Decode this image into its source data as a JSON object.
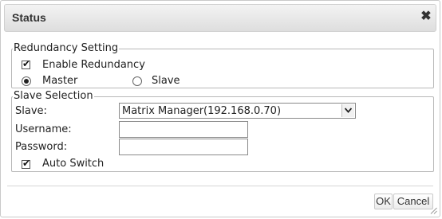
{
  "dialog": {
    "title": "Status",
    "close_glyph": "✖",
    "close_icon": "close-icon"
  },
  "redundancy": {
    "legend": "Redundancy Setting",
    "enable_label": "Enable Redundancy",
    "enable_checked": true,
    "role_options": [
      "Master",
      "Slave"
    ],
    "role_selected": "Master"
  },
  "slave_selection": {
    "legend": "Slave Selection",
    "slave_label": "Slave:",
    "slave_value": "Matrix Manager(192.168.0.70)",
    "username_label": "Username:",
    "username_value": "",
    "password_label": "Password:",
    "password_value": "",
    "auto_switch_label": "Auto Switch",
    "auto_switch_checked": true
  },
  "footer": {
    "ok_label": "OK",
    "cancel_label": "Cancel"
  }
}
